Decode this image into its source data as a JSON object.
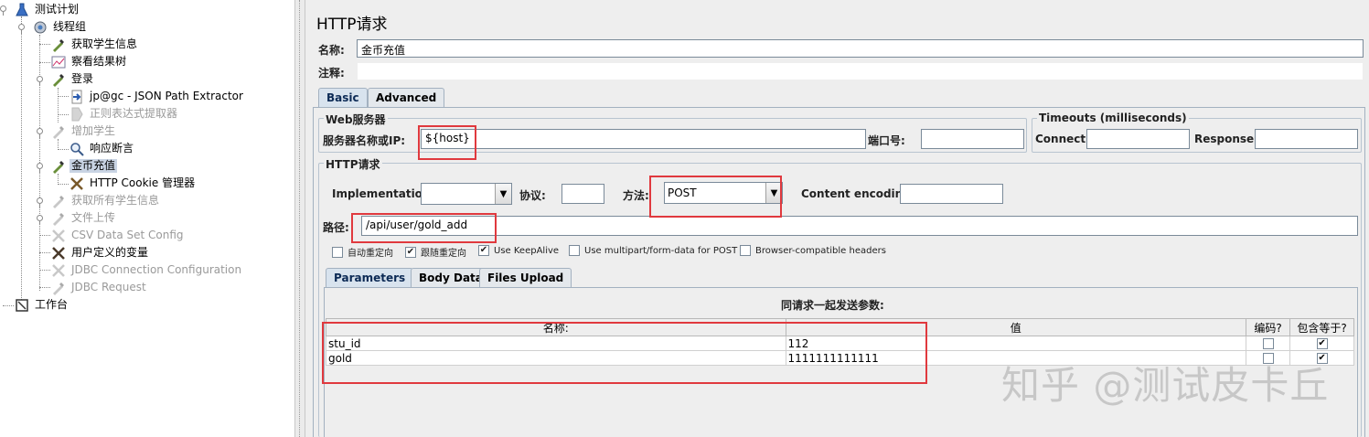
{
  "tree": {
    "items": [
      {
        "label": "测试计划",
        "icon": "test-plan-icon",
        "disabled": false,
        "selected": false
      },
      {
        "label": "线程组",
        "icon": "gear-icon",
        "disabled": false,
        "selected": false
      },
      {
        "label": "获取学生信息",
        "icon": "pipette-icon",
        "disabled": false,
        "selected": false
      },
      {
        "label": "察看结果树",
        "icon": "chart-icon",
        "disabled": false,
        "selected": false
      },
      {
        "label": "登录",
        "icon": "pipette-icon",
        "disabled": false,
        "selected": false
      },
      {
        "label": "jp@gc - JSON Path Extractor",
        "icon": "arrow-doc-icon",
        "disabled": false,
        "selected": false
      },
      {
        "label": "正则表达式提取器",
        "icon": "arrow-doc-icon",
        "disabled": true,
        "selected": false
      },
      {
        "label": "增加学生",
        "icon": "pipette-icon",
        "disabled": true,
        "selected": false
      },
      {
        "label": "响应断言",
        "icon": "magnifier-icon",
        "disabled": false,
        "selected": false
      },
      {
        "label": "金币充值",
        "icon": "pipette-icon",
        "disabled": false,
        "selected": true
      },
      {
        "label": "HTTP Cookie 管理器",
        "icon": "tools-icon",
        "disabled": false,
        "selected": false
      },
      {
        "label": "获取所有学生信息",
        "icon": "pipette-icon",
        "disabled": true,
        "selected": false
      },
      {
        "label": "文件上传",
        "icon": "pipette-icon",
        "disabled": true,
        "selected": false
      },
      {
        "label": "CSV Data Set Config",
        "icon": "tools-icon",
        "disabled": true,
        "selected": false
      },
      {
        "label": "用户定义的变量",
        "icon": "tools-icon",
        "disabled": false,
        "selected": false
      },
      {
        "label": "JDBC Connection Configuration",
        "icon": "tools-icon",
        "disabled": true,
        "selected": false
      },
      {
        "label": "JDBC Request",
        "icon": "pipette-icon",
        "disabled": true,
        "selected": false
      },
      {
        "label": "工作台",
        "icon": "workbench-icon",
        "disabled": false,
        "selected": false
      }
    ]
  },
  "panel": {
    "title": "HTTP请求",
    "name_label": "名称:",
    "name_value": "金币充值",
    "comment_label": "注释:",
    "comment_value": "",
    "tabs": [
      "Basic",
      "Advanced"
    ],
    "web_server": {
      "group_title": "Web服务器",
      "server_label": "服务器名称或IP:",
      "server_value": "${host}",
      "port_label": "端口号:",
      "port_value": ""
    },
    "timeouts": {
      "group_title": "Timeouts (milliseconds)",
      "connect_label": "Connect:",
      "connect_value": "",
      "response_label": "Response:",
      "response_value": ""
    },
    "http_request": {
      "group_title": "HTTP请求",
      "implementation_label": "Implementation:",
      "implementation_value": "",
      "protocol_label": "协议:",
      "protocol_value": "",
      "method_label": "方法:",
      "method_value": "POST",
      "encoding_label": "Content encoding:",
      "encoding_value": "",
      "path_label": "路径:",
      "path_value": "/api/user/gold_add"
    },
    "options": [
      {
        "label": "自动重定向",
        "checked": false
      },
      {
        "label": "跟随重定向",
        "checked": true
      },
      {
        "label": "Use KeepAlive",
        "checked": true
      },
      {
        "label": "Use multipart/form-data for POST",
        "checked": false
      },
      {
        "label": "Browser-compatible headers",
        "checked": false
      }
    ],
    "sub_tabs": [
      "Parameters",
      "Body Data",
      "Files Upload"
    ],
    "params_caption": "同请求一起发送参数:",
    "params_columns": [
      "名称:",
      "值",
      "编码?",
      "包含等于?"
    ],
    "params_rows": [
      {
        "name": "stu_id",
        "value": "112",
        "encode": false,
        "include_equals": true
      },
      {
        "name": "gold",
        "value": "1111111111111",
        "encode": false,
        "include_equals": true
      }
    ]
  },
  "watermark": "知乎 @测试皮卡丘",
  "colors": {
    "highlight_box": "#e0393e",
    "selected_node": "#c9d4e4",
    "disabled_text": "#9a9a9a"
  }
}
